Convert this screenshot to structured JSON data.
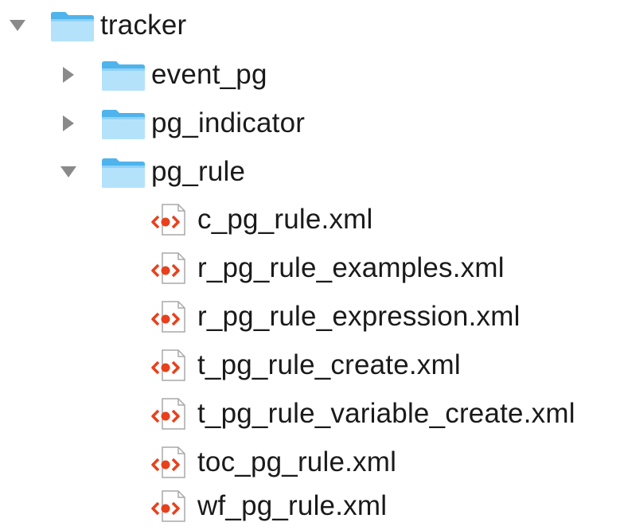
{
  "tree": {
    "root": {
      "name": "tracker",
      "expanded": true,
      "icon": "folder-icon"
    },
    "folders": [
      {
        "name": "event_pg",
        "expanded": false,
        "icon": "folder-icon"
      },
      {
        "name": "pg_indicator",
        "expanded": false,
        "icon": "folder-icon"
      },
      {
        "name": "pg_rule",
        "expanded": true,
        "icon": "folder-icon"
      }
    ],
    "files": [
      {
        "name": "c_pg_rule.xml",
        "icon": "xml-file-icon"
      },
      {
        "name": "r_pg_rule_examples.xml",
        "icon": "xml-file-icon"
      },
      {
        "name": "r_pg_rule_expression.xml",
        "icon": "xml-file-icon"
      },
      {
        "name": "t_pg_rule_create.xml",
        "icon": "xml-file-icon"
      },
      {
        "name": "t_pg_rule_variable_create.xml",
        "icon": "xml-file-icon"
      },
      {
        "name": "toc_pg_rule.xml",
        "icon": "xml-file-icon"
      },
      {
        "name": "wf_pg_rule.xml",
        "icon": "xml-file-icon"
      }
    ]
  },
  "colors": {
    "folder_light": "#b5e2fb",
    "folder_dark": "#4fb3ec",
    "xml_red": "#e8401c",
    "disclosure": "#8a8a8a",
    "text": "#1a1a1a"
  }
}
